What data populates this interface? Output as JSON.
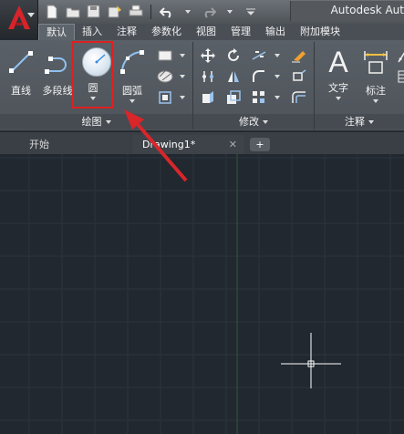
{
  "window": {
    "title": "Autodesk Aut"
  },
  "quick_access": [
    {
      "icon": "new-file-icon"
    },
    {
      "icon": "open-folder-icon"
    },
    {
      "icon": "save-icon"
    },
    {
      "icon": "save-as-icon"
    },
    {
      "icon": "print-icon"
    },
    {
      "icon": "undo-icon"
    },
    {
      "icon": "redo-icon"
    }
  ],
  "ribbon_tabs": [
    {
      "label": "默认",
      "active": true
    },
    {
      "label": "插入"
    },
    {
      "label": "注释"
    },
    {
      "label": "参数化"
    },
    {
      "label": "视图"
    },
    {
      "label": "管理"
    },
    {
      "label": "输出"
    },
    {
      "label": "附加模块"
    }
  ],
  "draw_panel": {
    "title": "绘图",
    "tools": [
      {
        "label": "直线",
        "icon": "line-icon"
      },
      {
        "label": "多段线",
        "icon": "polyline-icon"
      },
      {
        "label": "圆",
        "icon": "circle-icon",
        "highlighted": true
      },
      {
        "label": "圆弧",
        "icon": "arc-icon"
      }
    ]
  },
  "modify_panel": {
    "title": "修改"
  },
  "annotation_panel": {
    "title": "注释",
    "tools": [
      {
        "label": "文字",
        "icon": "text-icon"
      },
      {
        "label": "标注",
        "icon": "dimension-icon"
      }
    ]
  },
  "file_tabs": {
    "start": "开始",
    "drawing": "Drawing1*",
    "close": "✕",
    "new": "+"
  },
  "colors": {
    "highlight": "#e02020",
    "canvas": "#212830",
    "accent_red": "#cc1f1f"
  }
}
